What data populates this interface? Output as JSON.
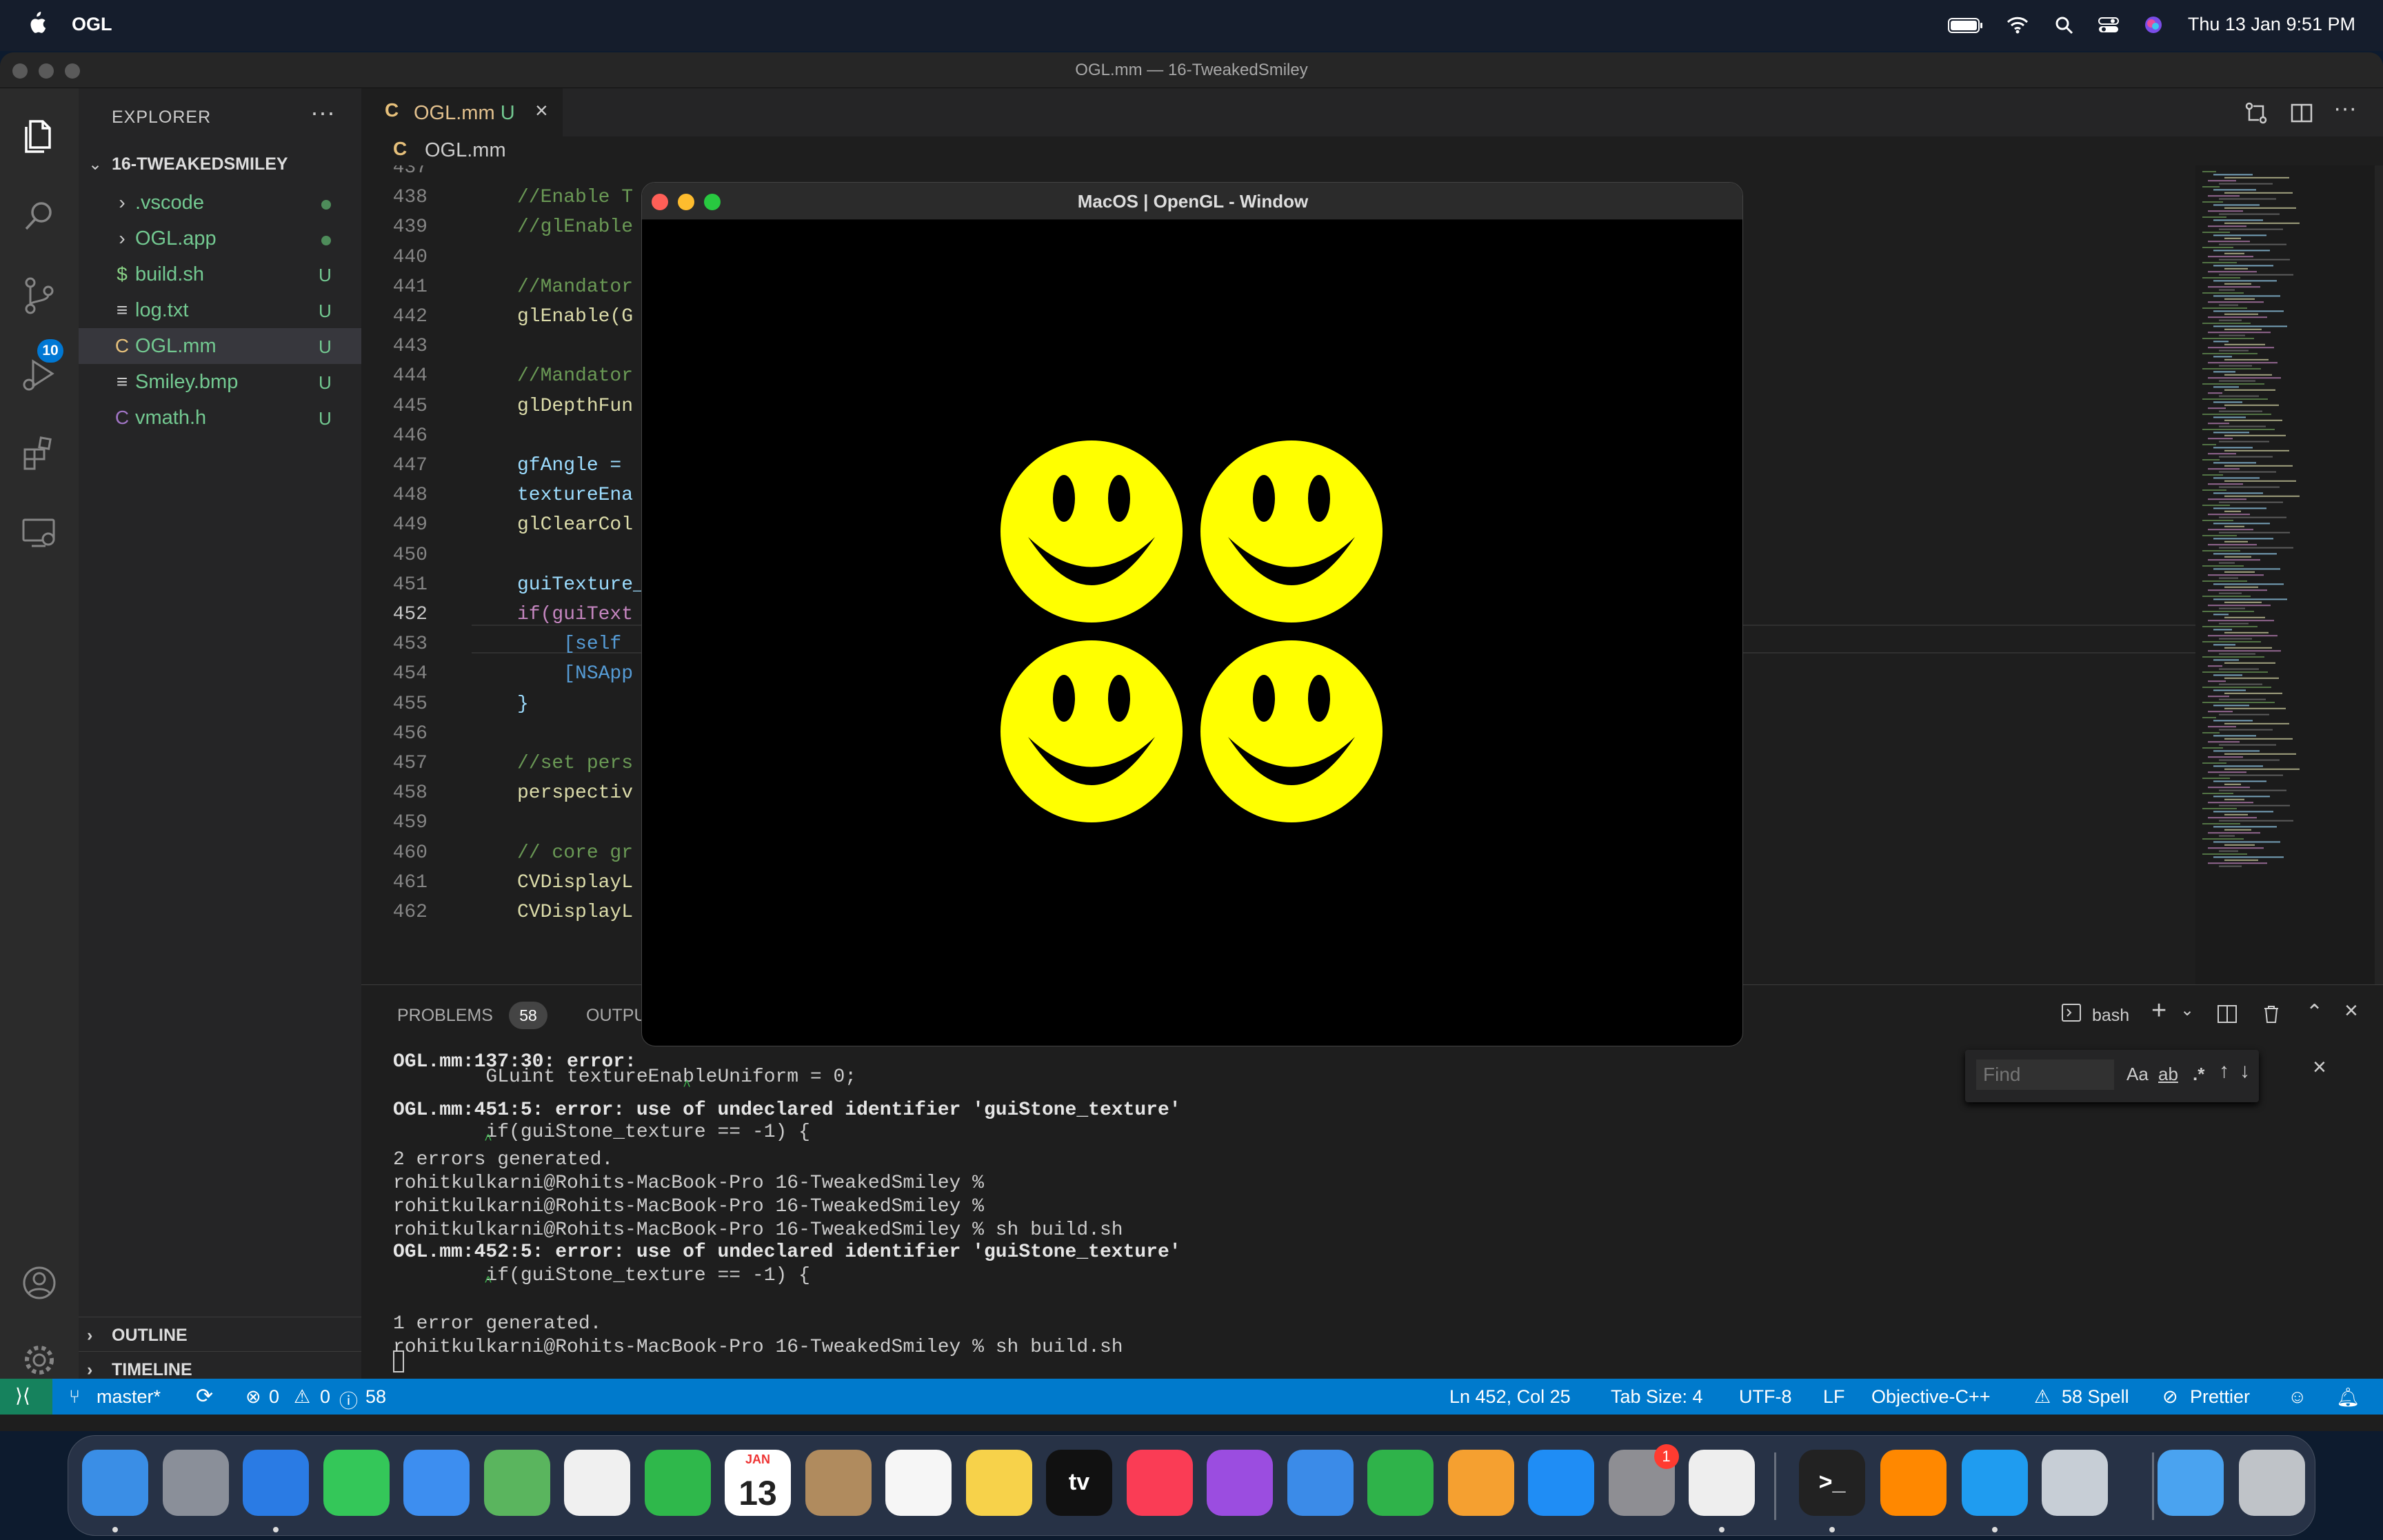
{
  "menubar": {
    "app_name": "OGL",
    "clock": "Thu 13 Jan  9:51 PM"
  },
  "window": {
    "title": "OGL.mm — 16-TweakedSmiley"
  },
  "activity_bar": {
    "scm_badge": "10"
  },
  "explorer": {
    "header": "EXPLORER",
    "more": "···",
    "root": "16-TWEAKEDSMILEY",
    "items": [
      {
        "icon": "›",
        "name": ".vscode",
        "tag": "",
        "color": "#73c991"
      },
      {
        "icon": "›",
        "name": "OGL.app",
        "tag": "",
        "color": "#73c991"
      },
      {
        "icon": "$",
        "name": "build.sh",
        "tag": "U",
        "color": "#73c991"
      },
      {
        "icon": "≡",
        "name": "log.txt",
        "tag": "U",
        "color": "#73c991"
      },
      {
        "icon": "C",
        "name": "OGL.mm",
        "tag": "U",
        "color": "#73c991"
      },
      {
        "icon": "≡",
        "name": "Smiley.bmp",
        "tag": "U",
        "color": "#73c991"
      },
      {
        "icon": "C",
        "name": "vmath.h",
        "tag": "U",
        "color": "#73c991"
      }
    ],
    "outline": "OUTLINE",
    "timeline": "TIMELINE"
  },
  "editor": {
    "tab": {
      "icon": "C",
      "name": "OGL.mm",
      "status": "U",
      "close": "×"
    },
    "breadcrumb": {
      "icon": "C",
      "file": "OGL.mm"
    },
    "lines": [
      {
        "num": "437",
        "code": ""
      },
      {
        "num": "438",
        "code": "//Enable T"
      },
      {
        "num": "439",
        "code": "//glEnable"
      },
      {
        "num": "440",
        "code": ""
      },
      {
        "num": "441",
        "code": "//Mandator"
      },
      {
        "num": "442",
        "code": "glEnable(G"
      },
      {
        "num": "443",
        "code": ""
      },
      {
        "num": "444",
        "code": "//Mandator"
      },
      {
        "num": "445",
        "code": "glDepthFun"
      },
      {
        "num": "446",
        "code": ""
      },
      {
        "num": "447",
        "code": "gfAngle = "
      },
      {
        "num": "448",
        "code": "textureEna"
      },
      {
        "num": "449",
        "code": "glClearCol"
      },
      {
        "num": "450",
        "code": ""
      },
      {
        "num": "451",
        "code": "guiTexture_"
      },
      {
        "num": "452",
        "code": "if(guiText"
      },
      {
        "num": "453",
        "code": "    [self"
      },
      {
        "num": "454",
        "code": "    [NSApp"
      },
      {
        "num": "455",
        "code": "}"
      },
      {
        "num": "456",
        "code": ""
      },
      {
        "num": "457",
        "code": "//set pers"
      },
      {
        "num": "458",
        "code": "perspectiv"
      },
      {
        "num": "459",
        "code": ""
      },
      {
        "num": "460",
        "code": "// core gr"
      },
      {
        "num": "461",
        "code": "CVDisplayL"
      },
      {
        "num": "462",
        "code": "CVDisplayL"
      }
    ]
  },
  "panel": {
    "problems_label": "PROBLEMS",
    "problems_count": "58",
    "output_label": "OUTPU",
    "shell": "bash",
    "terminal_lines": [
      "OGL.mm:137:30: error:",
      "        GLuint textureEnableUniform = 0;",
      "                                   ^",
      "OGL.mm:451:5: error: use of undeclared identifier 'guiStone_texture'",
      "        if(guiStone_texture == -1) {",
      "           ^",
      "2 errors generated.",
      "rohitkulkarni@Rohits-MacBook-Pro 16-TweakedSmiley %",
      "rohitkulkarni@Rohits-MacBook-Pro 16-TweakedSmiley %",
      "rohitkulkarni@Rohits-MacBook-Pro 16-TweakedSmiley % sh build.sh",
      "OGL.mm:452:5: error: use of undeclared identifier 'guiStone_texture'",
      "        if(guiStone_texture == -1) {",
      "           ^",
      "1 error generated.",
      "rohitkulkarni@Rohits-MacBook-Pro 16-TweakedSmiley % sh build.sh"
    ],
    "find": {
      "placeholder": "Find",
      "opt_case": "Aa",
      "opt_word": "ab",
      "opt_regex": ".*"
    }
  },
  "statusbar": {
    "branch": "master*",
    "errors": "0",
    "warnings": "0",
    "infos": "58",
    "position": "Ln 452, Col 25",
    "tab_size": "Tab Size: 4",
    "encoding": "UTF-8",
    "eol": "LF",
    "language": "Objective-C++",
    "spell": "58 Spell",
    "prettier": "Prettier"
  },
  "gl_window": {
    "title": "MacOS | OpenGL - Window",
    "smiley_color": "#ffff00"
  },
  "dock": {
    "items": [
      {
        "name": "Finder",
        "color": "#3a8ee6",
        "label": ""
      },
      {
        "name": "Launchpad",
        "color": "#8a8f99",
        "label": ""
      },
      {
        "name": "Safari",
        "color": "#2a7be4",
        "label": ""
      },
      {
        "name": "Messages",
        "color": "#34c759",
        "label": ""
      },
      {
        "name": "Mail",
        "color": "#3d8ef0",
        "label": ""
      },
      {
        "name": "Maps",
        "color": "#5ab55e",
        "label": ""
      },
      {
        "name": "Photos",
        "color": "#f0f0f0",
        "label": ""
      },
      {
        "name": "FaceTime",
        "color": "#2fb84b",
        "label": ""
      },
      {
        "name": "Calendar",
        "color": "#ffffff",
        "label": "13"
      },
      {
        "name": "Contacts",
        "color": "#b08b5e",
        "label": ""
      },
      {
        "name": "Reminders",
        "color": "#f6f6f6",
        "label": ""
      },
      {
        "name": "Notes",
        "color": "#f7d24a",
        "label": ""
      },
      {
        "name": "TV",
        "color": "#111111",
        "label": "tv"
      },
      {
        "name": "Music",
        "color": "#fa3c55",
        "label": ""
      },
      {
        "name": "Podcasts",
        "color": "#9b4de0",
        "label": ""
      },
      {
        "name": "Keynote",
        "color": "#3b8be8",
        "label": ""
      },
      {
        "name": "Numbers",
        "color": "#2fb34a",
        "label": ""
      },
      {
        "name": "Pages",
        "color": "#f5a030",
        "label": ""
      },
      {
        "name": "App Store",
        "color": "#1f8df5",
        "label": ""
      },
      {
        "name": "System Preferences",
        "color": "#8e8e93",
        "label": ""
      },
      {
        "name": "TextEdit",
        "color": "#eeeeee",
        "label": ""
      },
      {
        "name": "Terminal",
        "color": "#222222",
        "label": ">_"
      },
      {
        "name": "VLC",
        "color": "#ff8800",
        "label": ""
      },
      {
        "name": "VS Code",
        "color": "#1f9cf0",
        "label": ""
      },
      {
        "name": "Preview",
        "color": "#c7ced6",
        "label": ""
      },
      {
        "name": "Downloads",
        "color": "#4aa3f0",
        "label": ""
      },
      {
        "name": "Trash",
        "color": "#bfc3c8",
        "label": ""
      }
    ],
    "sysprefs_badge": "1",
    "calendar_month": "JAN"
  }
}
